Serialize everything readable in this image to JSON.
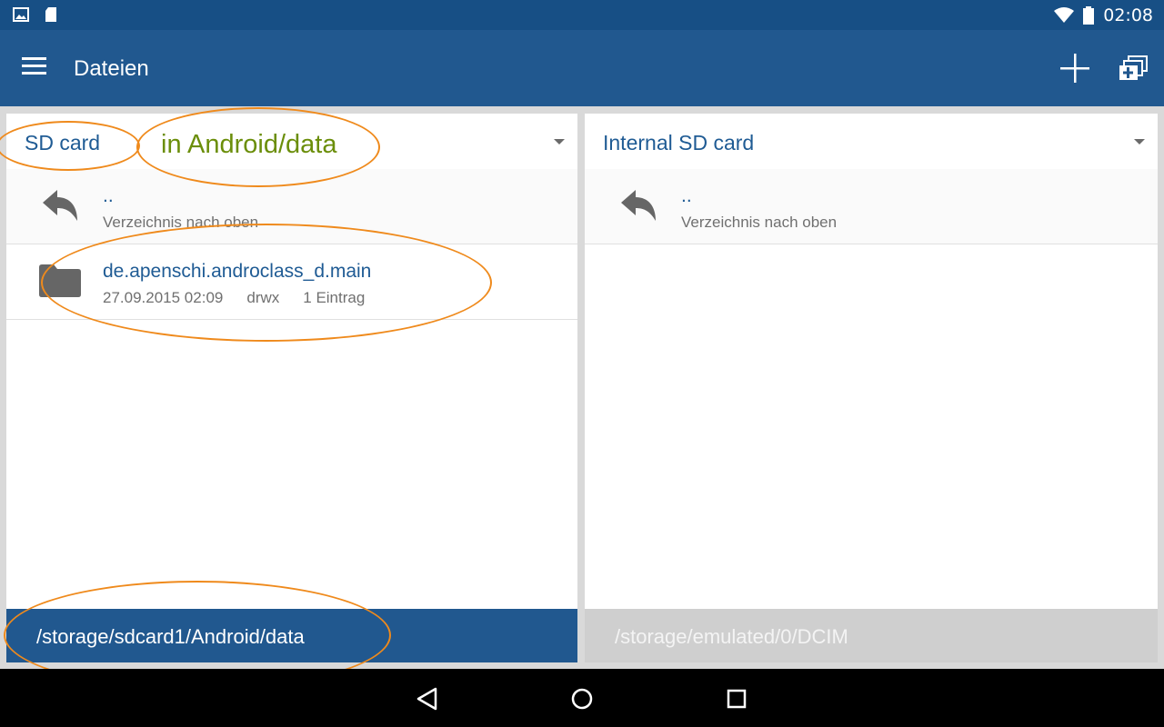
{
  "status_bar": {
    "time": "02:08",
    "left_icons": [
      "image-notification-icon",
      "sd-card-notification-icon"
    ],
    "right_icons": [
      "wifi-icon",
      "battery-icon"
    ]
  },
  "app_bar": {
    "title": "Dateien",
    "actions": [
      "add-icon",
      "windows-icon"
    ]
  },
  "left_pane": {
    "location": "SD card",
    "annotation_label": "in Android/data",
    "rows": [
      {
        "title": "..",
        "subtitle": "Verzeichnis nach oben",
        "icon": "reply-arrow-icon"
      },
      {
        "title": "de.apenschi.androclass_d.main",
        "date": "27.09.2015 02:09",
        "permissions": "drwx",
        "entries": "1 Eintrag",
        "icon": "folder-icon"
      }
    ],
    "path": "/storage/sdcard1/Android/data"
  },
  "right_pane": {
    "location": "Internal SD card",
    "rows": [
      {
        "title": "..",
        "subtitle": "Verzeichnis nach oben",
        "icon": "reply-arrow-icon"
      }
    ],
    "path": "/storage/emulated/0/DCIM"
  },
  "colors": {
    "status_bar": "#174f85",
    "app_bar": "#21588f",
    "accent_text": "#1f5b94",
    "annotation": "#ef8a1c",
    "annotation_text": "#6b8e0a"
  },
  "nav_bar": {
    "buttons": [
      "back-icon",
      "home-icon",
      "recents-icon"
    ]
  }
}
